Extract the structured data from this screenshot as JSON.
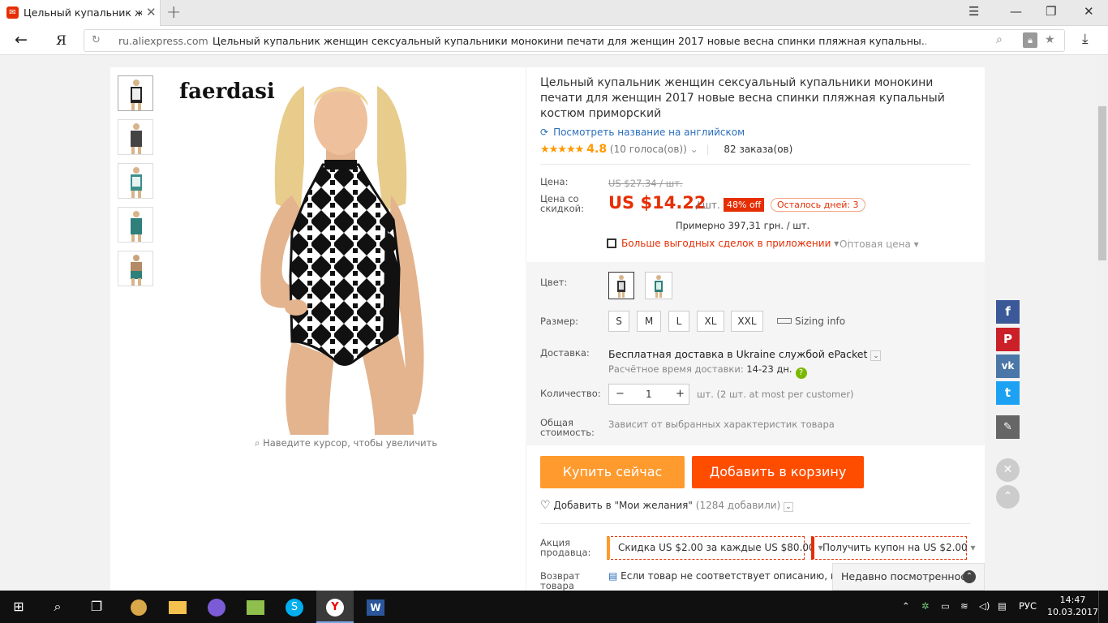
{
  "browser": {
    "tab_title": "Цельный купальник жен",
    "url_host": "ru.aliexpress.com",
    "url_path": "Цельный купальник женщин сексуальный купальники монокини печати для женщин 2017 новые весна спинки пляжная купальны…"
  },
  "product": {
    "brand_logo": "faerdasi",
    "zoom_hint": "Наведите курсор, чтобы увеличить",
    "title": "Цельный купальник женщин сексуальный купальники монокини печати для женщин 2017 новые весна спинки пляжная купальный костюм приморский",
    "english_link": "Посмотреть название на английском",
    "stars": "★★★★★",
    "rating": "4.8",
    "votes": "(10 голоса(ов))",
    "orders": "82 заказа(ов)",
    "price_label": "Цена:",
    "old_price": "US $27.34 / шт.",
    "discount_label": "Цена со скидкой:",
    "price": "US $14.22",
    "per_unit": "/ шт.",
    "off_badge": "48% off",
    "days_left": "Осталось дней: 3",
    "approx": "Примерно 397,31 грн. / шт.",
    "app_deals": "Больше выгодных сделок в приложении",
    "wholesale": "Оптовая цена",
    "color_label": "Цвет:",
    "size_label": "Размер:",
    "sizes": [
      "S",
      "M",
      "L",
      "XL",
      "XXL"
    ],
    "sizing_info": "Sizing info",
    "shipping_label": "Доставка:",
    "shipping_prefix": "Бесплатная доставка в",
    "shipping_dest": "Ukraine службой ePacket",
    "delivery_time_label": "Расчётное время доставки:",
    "delivery_time": "14-23 дн.",
    "qty_label": "Количество:",
    "qty": "1",
    "qty_note": "шт. (2 шт. at most per customer)",
    "total_label": "Общая стоимость:",
    "total_note": "Зависит от выбранных характеристик товара",
    "buy_now": "Купить сейчас",
    "add_cart": "Добавить в корзину",
    "wishlist": "Добавить в \"Мои желания\"",
    "wishlist_count": "(1284 добавили)",
    "seller_promo_label": "Акция продавца:",
    "promo1": "Скидка US $2.00 за каждые US $80.00",
    "promo2": "Получить купон на US $2.00",
    "return_label": "Возврат товара",
    "return_text": "Если товар не соответствует описанию, вы м… оплатив стоимость обратной пересылки, или…"
  },
  "sidebar": {
    "recently_viewed": "Недавно посмотренное"
  },
  "taskbar": {
    "lang": "РУС",
    "time": "14:47",
    "date": "10.03.2017"
  },
  "colors": {
    "accent": "#e62e04",
    "buy": "#ff9a2e",
    "cart": "#ff4d00",
    "link": "#2a6ebb",
    "facebook": "#3b5998",
    "pinterest": "#cb2027",
    "vk": "#4a76a8",
    "twitter": "#1da1f2"
  }
}
